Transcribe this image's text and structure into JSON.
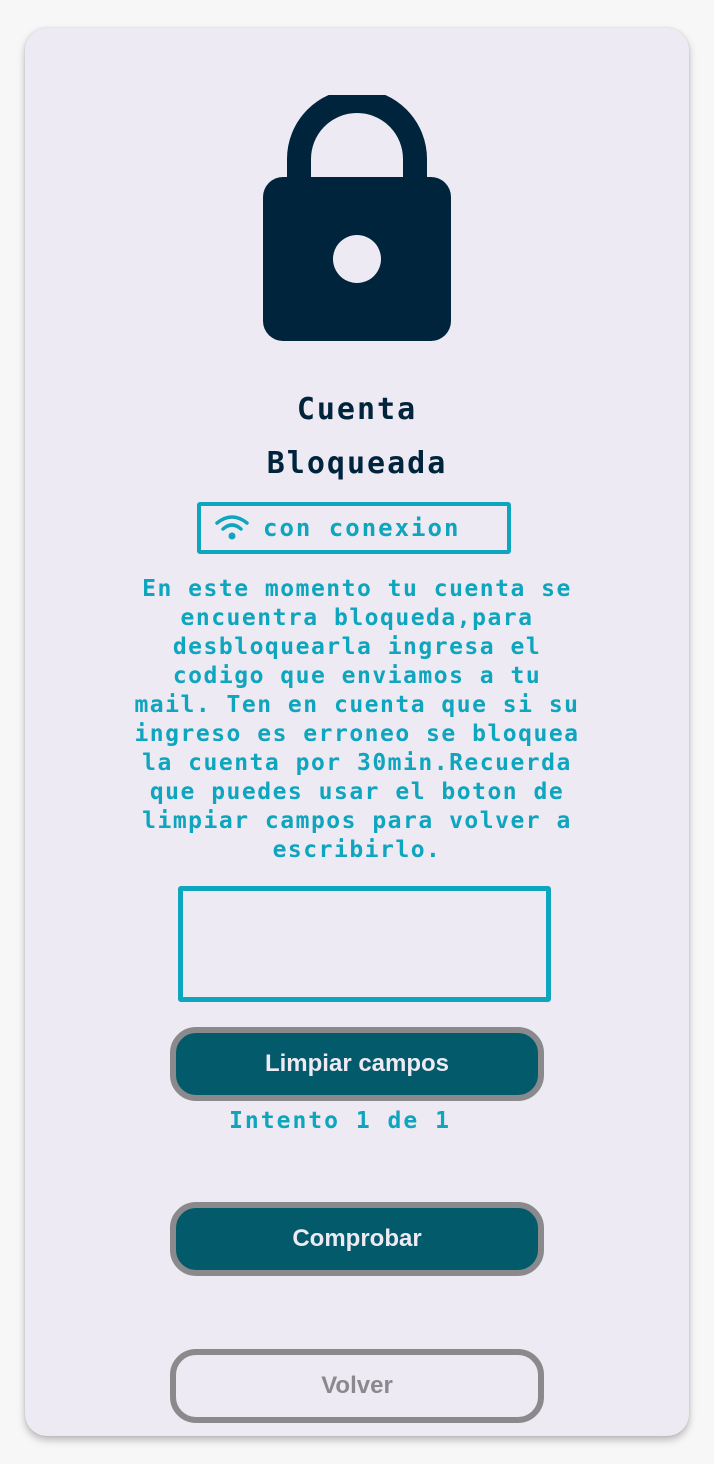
{
  "colors": {
    "background": "#eeeaf4",
    "accent": "#0ea5be",
    "dark_text": "#00243c",
    "button_fill": "#035a6b",
    "button_border": "#8a8a8c"
  },
  "icons": {
    "lock": "lock-icon",
    "wifi": "wifi-icon"
  },
  "header": {
    "title_line1": "Cuenta",
    "title_line2": "Bloqueada"
  },
  "connection": {
    "label": "con conexion"
  },
  "message": {
    "text": "En este momento tu cuenta se\nencuentra bloqueda,para\ndesbloquearla ingresa el\ncodigo que enviamos a tu\nmail. Ten en cuenta que si su\ningreso es erroneo se bloquea\nla cuenta por 30min.Recuerda\nque puedes usar el boton de\nlimpiar campos para volver a\nescribirlo."
  },
  "code_input": {
    "value": ""
  },
  "buttons": {
    "clear_label": "Limpiar campos",
    "check_label": "Comprobar",
    "back_label": "Volver"
  },
  "attempts": {
    "text": "Intento 1 de 1"
  }
}
